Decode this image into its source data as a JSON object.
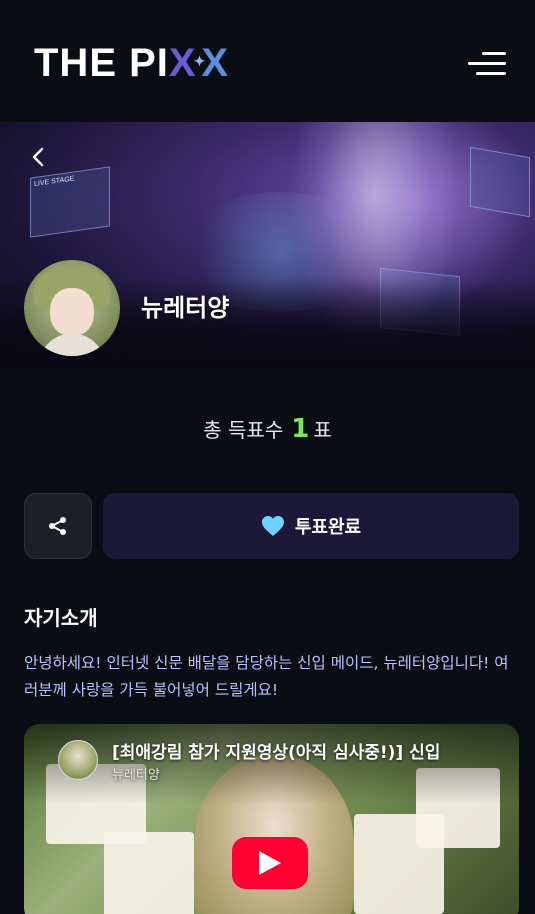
{
  "header": {
    "logo_text": "THE PIXX",
    "logo_parts": {
      "main": "THE PI",
      "x1": "X",
      "x2": "X"
    },
    "menu_icon": "hamburger-menu-icon"
  },
  "profile": {
    "name": "뉴레터양",
    "back_icon": "chevron-left-icon"
  },
  "votes": {
    "prefix": "총 득표수",
    "count": "1",
    "suffix": "표"
  },
  "actions": {
    "share_icon": "share-icon",
    "vote_label": "투표완료",
    "vote_icon": "heart-icon",
    "vote_icon_color": "#6fd3ff"
  },
  "intro": {
    "title": "자기소개",
    "text": "안녕하세요! 인터넷 신문 배달을 담당하는 신입 메이드, 뉴레터양입니다! 여러분께 사랑을 가득 불어넣어 드릴게요!"
  },
  "video": {
    "title": "[최애강림 참가 지원영상(아직 심사중!)] 신입",
    "channel": "뉴레터양",
    "play_icon": "youtube-play-icon",
    "play_color": "#ff0033"
  },
  "colors": {
    "background": "#0a0d14",
    "vote_count": "#7ee85a",
    "intro_text": "#b7c3ff",
    "vote_button_bg": "#1c1838"
  }
}
